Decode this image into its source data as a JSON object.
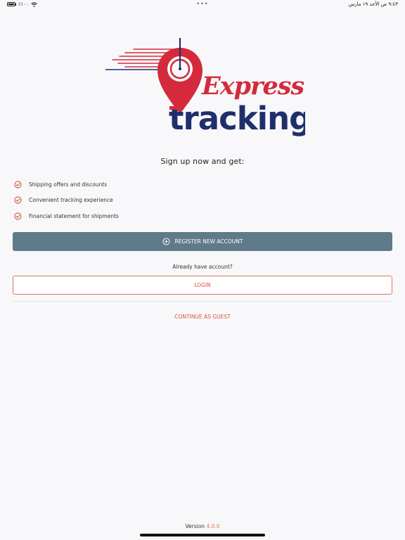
{
  "status_bar": {
    "battery_text": "٪١٠٠",
    "datetime_text": "٩:٤٣ ص   الأحد ١٩ مارس",
    "center_dots": "•••"
  },
  "logo": {
    "word1": "Express",
    "word2": "tracking",
    "colors": {
      "red": "#d42a3c",
      "navy": "#1f2f6b"
    }
  },
  "headline": "Sign up now and get:",
  "benefits": [
    {
      "label": "Shipping offers and discounts",
      "icon": "check-circle-icon"
    },
    {
      "label": "Convenient tracking experience",
      "icon": "check-circle-icon"
    },
    {
      "label": "Financial statement for shipments",
      "icon": "check-circle-icon"
    }
  ],
  "register": {
    "label": "REGISTER NEW ACCOUNT",
    "icon": "plus-circle-icon"
  },
  "already_text": "Already have account?",
  "login": {
    "label": "LOGIN"
  },
  "guest": {
    "label": "CONTINUE AS GUEST"
  },
  "version": {
    "label": "Version",
    "number": "4.0.0"
  },
  "colors": {
    "accent": "#d9543e",
    "primary_button": "#5f7b8a",
    "background": "#f8f8fa"
  }
}
